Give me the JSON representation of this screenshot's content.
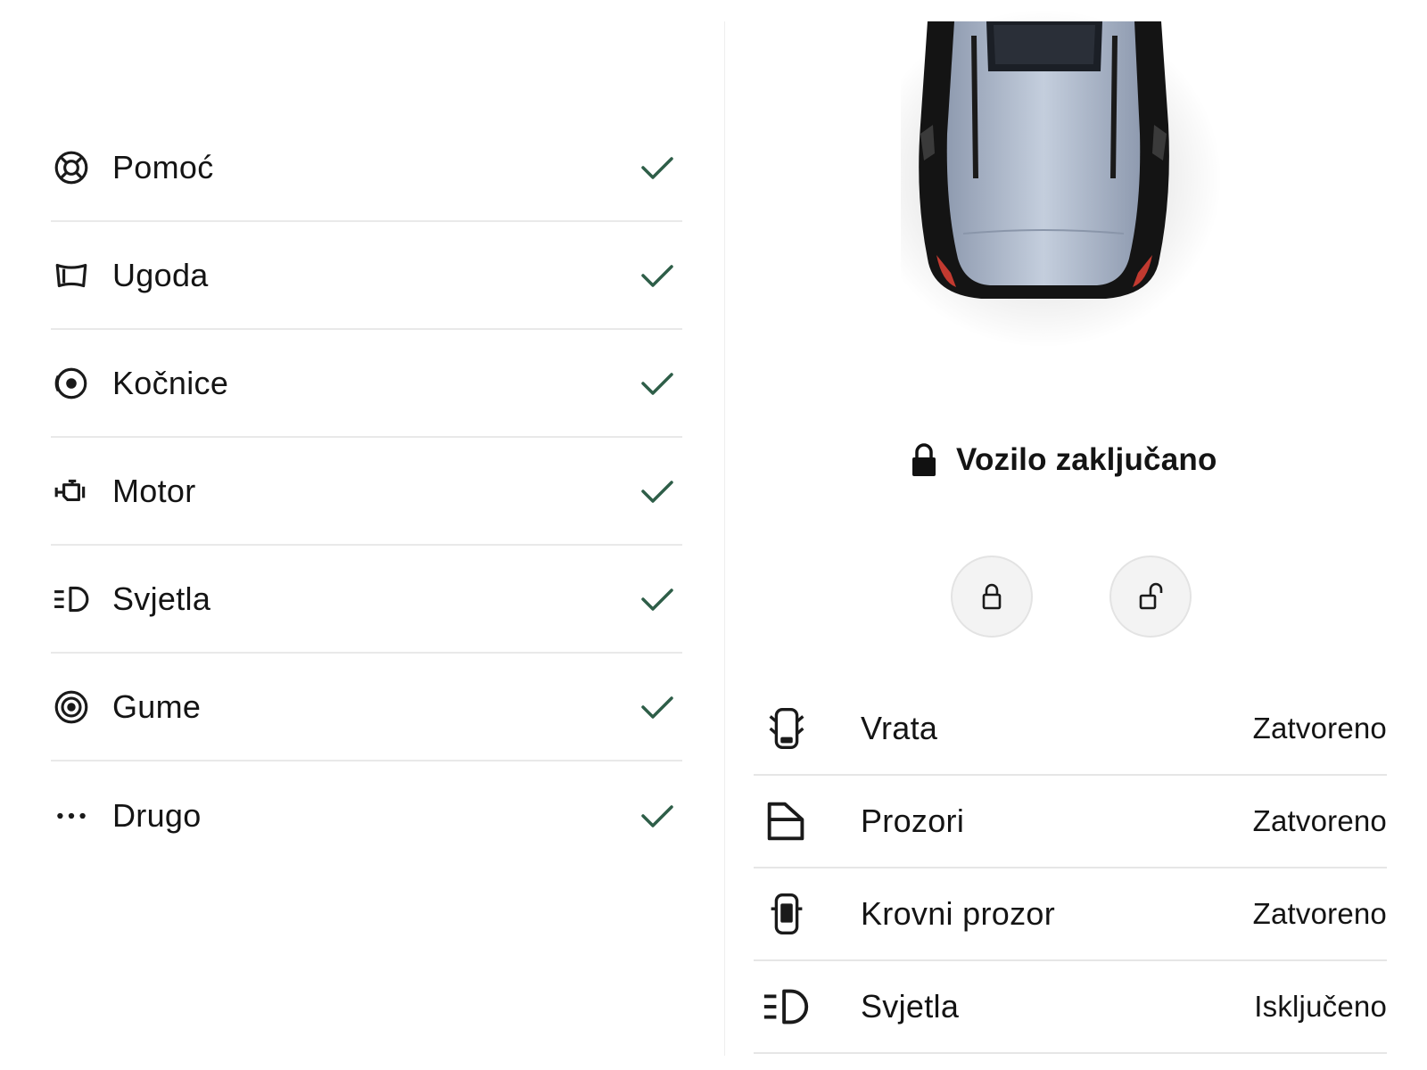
{
  "checks": {
    "items": [
      {
        "label": "Pomoć",
        "icon": "lifebuoy-icon",
        "status": "ok"
      },
      {
        "label": "Ugoda",
        "icon": "seat-icon",
        "status": "ok"
      },
      {
        "label": "Kočnice",
        "icon": "brake-icon",
        "status": "ok"
      },
      {
        "label": "Motor",
        "icon": "engine-icon",
        "status": "ok"
      },
      {
        "label": "Svjetla",
        "icon": "headlight-icon",
        "status": "ok"
      },
      {
        "label": "Gume",
        "icon": "tire-icon",
        "status": "ok"
      },
      {
        "label": "Drugo",
        "icon": "more-dots-icon",
        "status": "ok"
      }
    ],
    "check_color": "#2e5e48"
  },
  "vehicle": {
    "lock_status_text": "Vozilo zaključano",
    "lock_status_icon": "padlock-icon",
    "lock_button_icon": "lock-icon",
    "unlock_button_icon": "unlock-icon"
  },
  "status_list": {
    "items": [
      {
        "label": "Vrata",
        "value": "Zatvoreno",
        "icon": "car-doors-icon"
      },
      {
        "label": "Prozori",
        "value": "Zatvoreno",
        "icon": "car-window-icon"
      },
      {
        "label": "Krovni prozor",
        "value": "Zatvoreno",
        "icon": "sunroof-icon"
      },
      {
        "label": "Svjetla",
        "value": "Isključeno",
        "icon": "headlight-icon"
      }
    ]
  }
}
